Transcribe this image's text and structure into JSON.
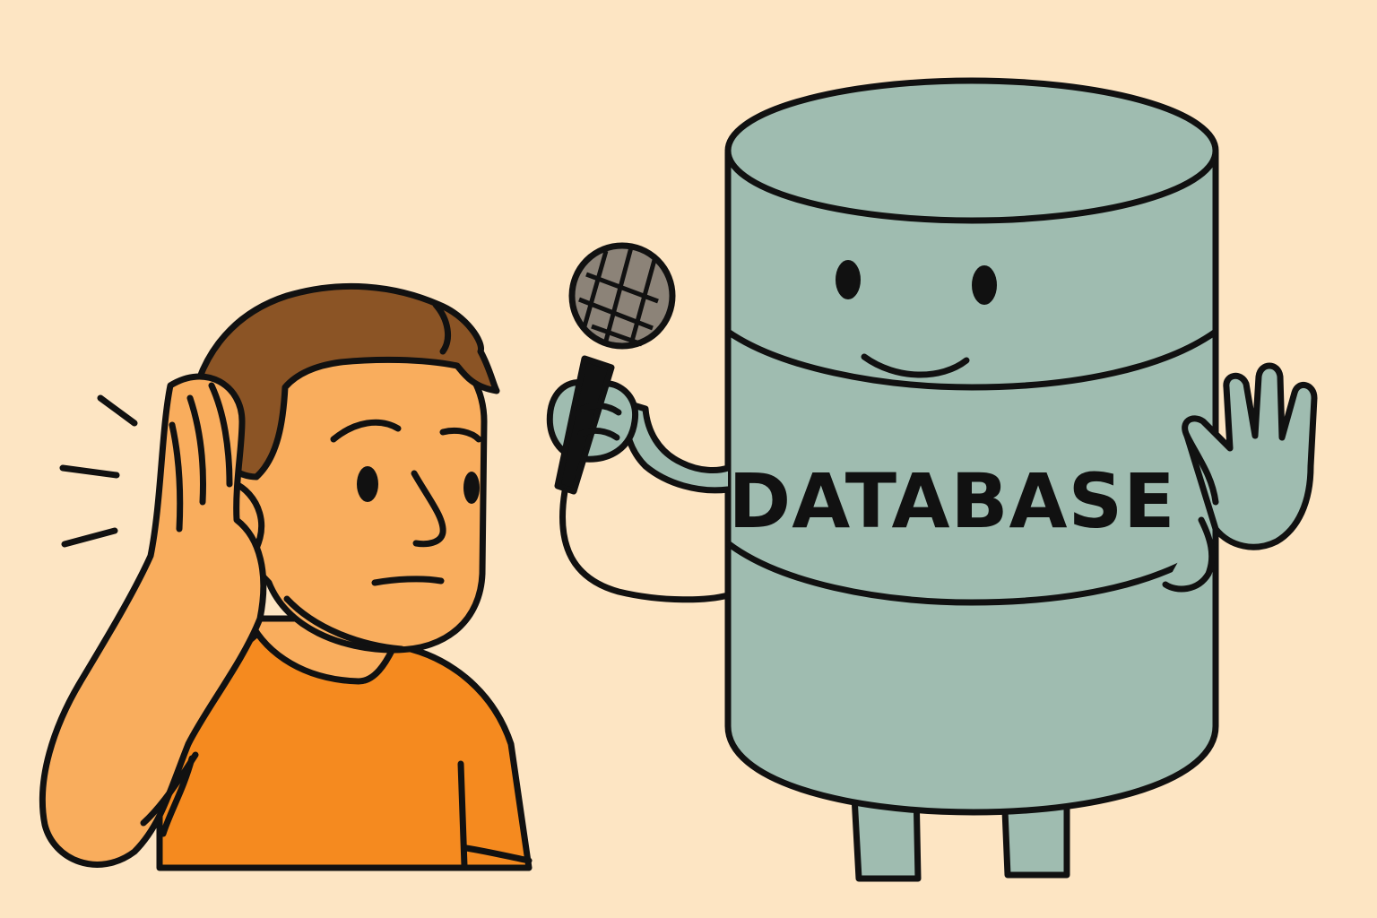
{
  "database_label": "DATABASE",
  "colors": {
    "background": "#fde5c3",
    "skin": "#f9ad5d",
    "hair": "#8b5425",
    "shirt": "#f58a1f",
    "database_body": "#9fbcb0",
    "microphone_head": "#8c8378",
    "outline": "#111111"
  },
  "icons": {
    "person": "cupped-ear-person-icon",
    "database": "database-cylinder-icon",
    "microphone": "microphone-icon",
    "sound": "sound-lines-icon"
  }
}
